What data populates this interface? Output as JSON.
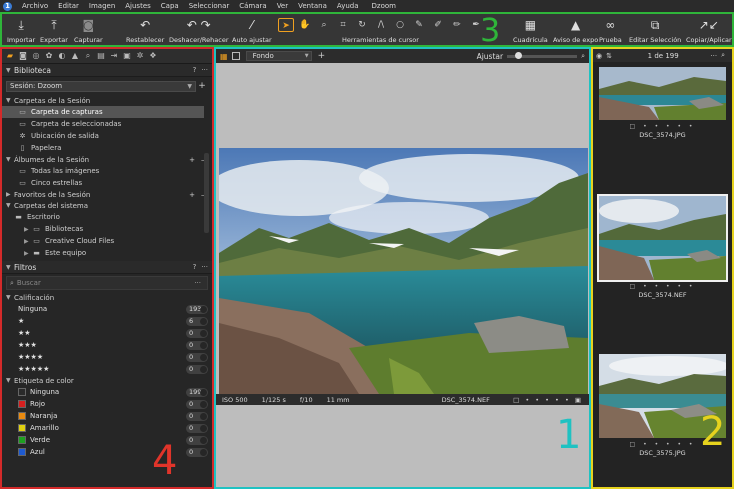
{
  "menubar": {
    "items": [
      "Archivo",
      "Editar",
      "Imagen",
      "Ajustes",
      "Capa",
      "Seleccionar",
      "Cámara",
      "Ver",
      "Ventana",
      "Ayuda"
    ],
    "window_title": "Dzoom"
  },
  "toolbar": {
    "import": "Importar",
    "export": "Exportar",
    "capture": "Capturar",
    "reset": "Restablecer",
    "undo_redo": "Deshacer/Rehacer",
    "auto_adjust": "Auto ajustar",
    "cursor_tools": "Herramientas de cursor",
    "grid": "Cuadrícula",
    "exposure_warning": "Aviso de expo",
    "proof": "Prueba",
    "edit_selection": "Editar Selección",
    "copy_apply": "Copiar/Aplicar"
  },
  "zone_numbers": {
    "toolbar": "3",
    "browser": "2",
    "viewer": "1",
    "tools": "4"
  },
  "library": {
    "title": "Biblioteca",
    "session": "Sesión: Dzoom",
    "session_folders_title": "Carpetas de la Sesión",
    "session_folders": [
      "Carpeta de capturas",
      "Carpeta de seleccionadas",
      "Ubicación de salida",
      "Papelera"
    ],
    "albums_title": "Álbumes de la Sesión",
    "albums": [
      "Todas las imágenes",
      "Cinco estrellas"
    ],
    "favorites_title": "Favoritos de la Sesión",
    "system_folders_title": "Carpetas del sistema",
    "system_folders": [
      "Escritorio",
      "Bibliotecas",
      "Creative Cloud Files",
      "Este equipo"
    ]
  },
  "filters": {
    "title": "Filtros",
    "search_placeholder": "Buscar",
    "rating_title": "Calificación",
    "ratings": [
      {
        "label": "Ninguna",
        "count": "193"
      },
      {
        "label": "★",
        "count": "6"
      },
      {
        "label": "★★",
        "count": "0"
      },
      {
        "label": "★★★",
        "count": "0"
      },
      {
        "label": "★★★★",
        "count": "0"
      },
      {
        "label": "★★★★★",
        "count": "0"
      }
    ],
    "color_title": "Etiqueta de color",
    "colors": [
      {
        "label": "Ninguna",
        "count": "199",
        "color": "#2a2a2a"
      },
      {
        "label": "Rojo",
        "count": "0",
        "color": "#d62020"
      },
      {
        "label": "Naranja",
        "count": "0",
        "color": "#e88a10"
      },
      {
        "label": "Amarillo",
        "count": "0",
        "color": "#e0d010"
      },
      {
        "label": "Verde",
        "count": "0",
        "color": "#1ea020"
      },
      {
        "label": "Azul",
        "count": "0",
        "color": "#1e5ad0"
      }
    ]
  },
  "viewer": {
    "background_select": "Fondo",
    "adjust_label": "Ajustar",
    "iso": "ISO 500",
    "shutter": "1/125 s",
    "aperture": "f/10",
    "focal": "11 mm",
    "filename": "DSC_3574.NEF"
  },
  "browser": {
    "count": "1 de 199",
    "thumbs": [
      {
        "name": "DSC_3574.JPG"
      },
      {
        "name": "DSC_3574.NEF"
      },
      {
        "name": "DSC_3575.JPG"
      }
    ]
  },
  "colors": {
    "accent": "#f0a020",
    "zone1": "#1fc2c2",
    "zone2": "#e6d21e",
    "zone3": "#2fb53a",
    "zone4": "#e0342a"
  }
}
